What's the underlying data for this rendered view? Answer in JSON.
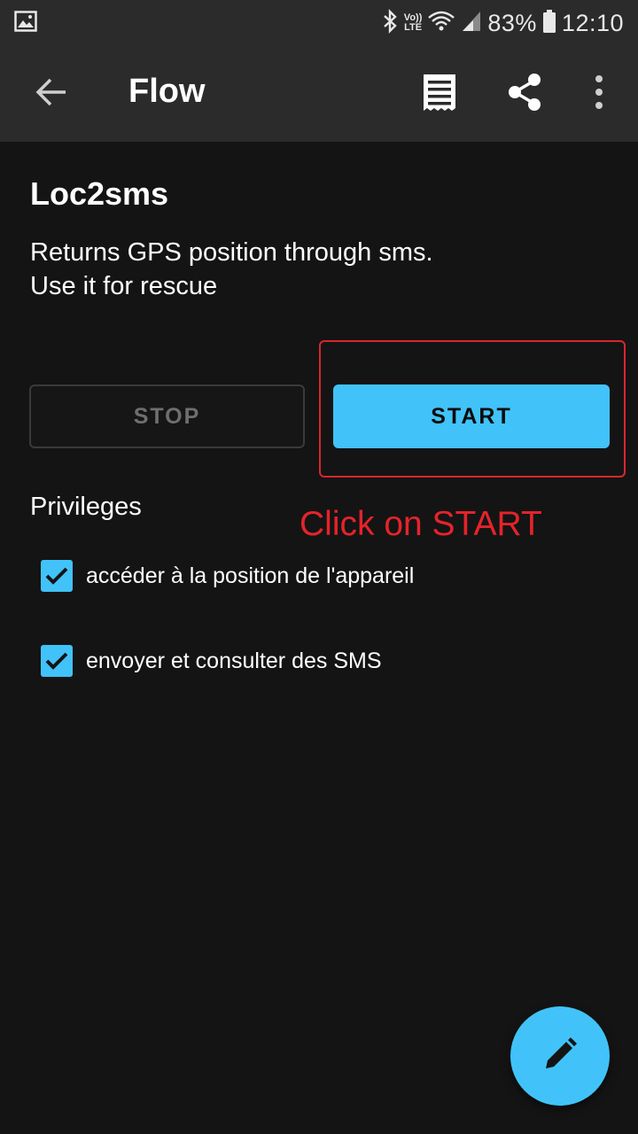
{
  "status_bar": {
    "network_label_top": "Vo))",
    "network_label_bottom": "LTE",
    "battery_percent": "83%",
    "time": "12:10",
    "icons": [
      "gallery-icon",
      "bluetooth-icon",
      "wifi-icon",
      "signal-icon",
      "battery-icon"
    ]
  },
  "app_bar": {
    "title": "Flow",
    "icons": [
      "back-arrow-icon",
      "log-icon",
      "share-icon",
      "more-vert-icon"
    ]
  },
  "flow": {
    "name": "Loc2sms",
    "description_line1": "Returns GPS position through sms.",
    "description_line2": "Use it for rescue"
  },
  "buttons": {
    "stop_label": "STOP",
    "start_label": "START"
  },
  "annotation": {
    "text": "Click on START",
    "color": "#e5232b"
  },
  "privileges": {
    "title": "Privileges",
    "items": [
      {
        "label": "accéder à la position de l'appareil",
        "checked": true
      },
      {
        "label": "envoyer et consulter des SMS",
        "checked": true
      }
    ]
  },
  "colors": {
    "accent": "#41c3f9",
    "background": "#141414",
    "toolbar": "#2b2b2b"
  },
  "fab": {
    "icon": "pencil-icon"
  }
}
